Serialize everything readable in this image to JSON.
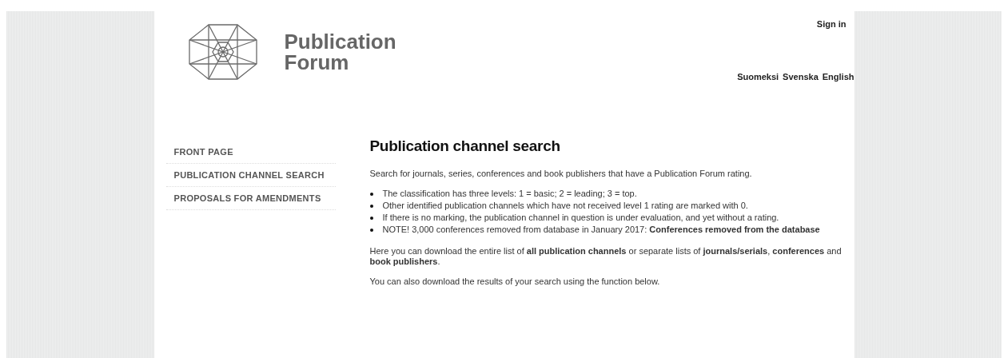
{
  "header": {
    "logo_text": [
      "Publication",
      "Forum"
    ],
    "sign_in": "Sign in",
    "languages": [
      "Suomeksi",
      "Svenska",
      "English"
    ]
  },
  "sidebar": {
    "items": [
      {
        "label": "FRONT PAGE"
      },
      {
        "label": "PUBLICATION CHANNEL SEARCH"
      },
      {
        "label": "PROPOSALS FOR AMENDMENTS"
      }
    ]
  },
  "content": {
    "title": "Publication channel search",
    "intro": "Search for journals, series, conferences and book publishers that have a Publication Forum rating.",
    "bullets": [
      "The classification has three levels: 1 = basic; 2 = leading; 3 = top.",
      "Other identified publication channels which have not received level 1 rating are marked with 0.",
      "If there is no marking, the publication channel in question is under evaluation, and yet without a rating.",
      "NOTE! 3,000 conferences removed from database in January 2017: **Conferences removed from the database**"
    ],
    "paragraphs": [
      "Here you can download the entire list of **all publication channels** or separate lists of **journals/serials**, **conferences** and **book publishers**.",
      "You can also download the results of your search using the function below."
    ]
  }
}
